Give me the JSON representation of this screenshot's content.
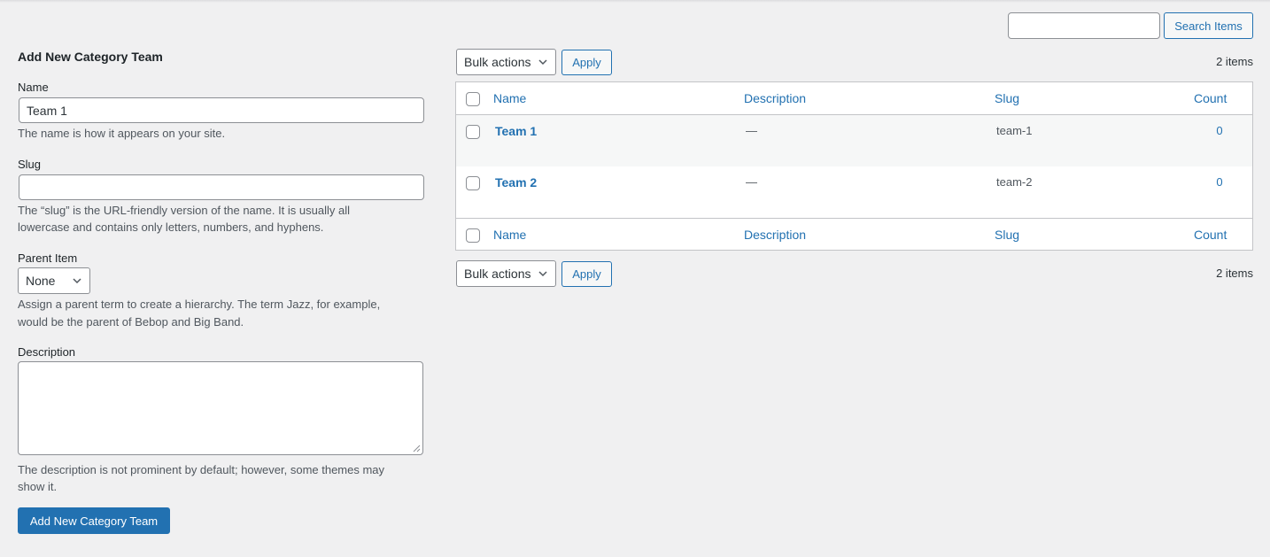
{
  "form": {
    "title": "Add New Category Team",
    "name_label": "Name",
    "name_value": "Team 1",
    "name_help": "The name is how it appears on your site.",
    "slug_label": "Slug",
    "slug_value": "",
    "slug_help_1": "The “slug” is the URL-friendly version of the name. It is usually all",
    "slug_help_2": "lowercase and contains only letters, numbers, and hyphens.",
    "parent_label": "Parent Item",
    "parent_selected": "None",
    "parent_help_1": "Assign a parent term to create a hierarchy. The term Jazz, for example,",
    "parent_help_2": "would be the parent of Bebop and Big Band.",
    "description_label": "Description",
    "description_value": "",
    "description_help_1": "The description is not prominent by default; however, some themes may",
    "description_help_2": "show it.",
    "submit_label": "Add New Category Team"
  },
  "search": {
    "placeholder": "",
    "button_label": "Search Items"
  },
  "tablenav": {
    "bulk_actions_label": "Bulk actions",
    "apply_label": "Apply",
    "item_count": "2 items"
  },
  "table": {
    "columns": {
      "name": "Name",
      "description": "Description",
      "slug": "Slug",
      "count": "Count"
    },
    "rows": [
      {
        "name": "Team 1",
        "description": "—",
        "slug": "team-1",
        "count": "0"
      },
      {
        "name": "Team 2",
        "description": "—",
        "slug": "team-2",
        "count": "0"
      }
    ]
  },
  "colors": {
    "accent": "#2271b1",
    "background": "#f0f0f1",
    "border": "#c3c4c7"
  },
  "icons": {
    "select_arrow": "chevron-down-icon",
    "resize": "resize-grip-icon"
  }
}
